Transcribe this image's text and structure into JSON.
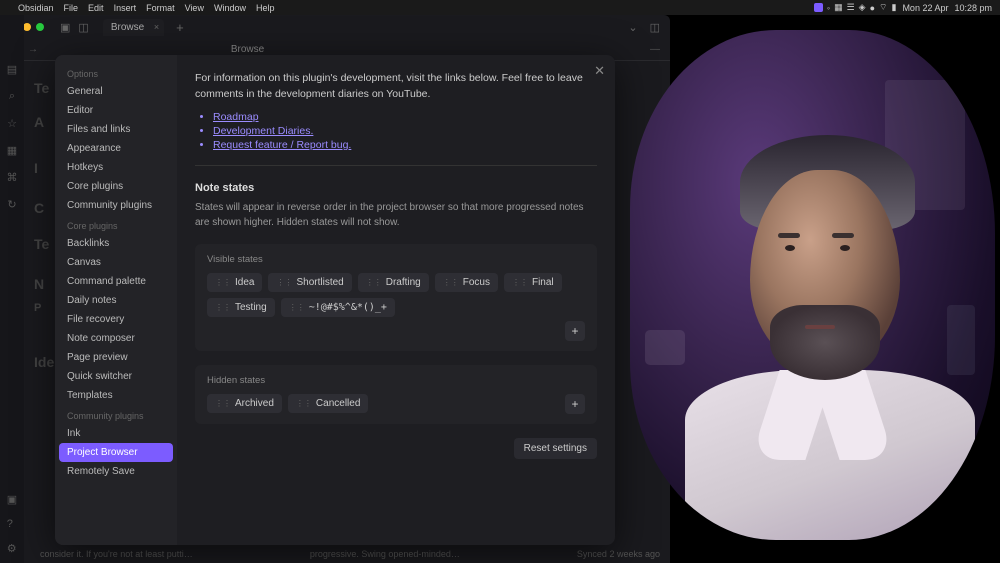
{
  "menubar": {
    "app": "Obsidian",
    "items": [
      "File",
      "Edit",
      "Insert",
      "Format",
      "View",
      "Window",
      "Help"
    ],
    "date": "Mon 22 Apr",
    "time": "10:28 pm"
  },
  "window": {
    "tab_title": "Browse",
    "sub_title": "Browse"
  },
  "bg_doc": {
    "t1": "Te",
    "t2": "A",
    "t3": "I",
    "t4": "C",
    "t5": "Te",
    "t6": "N",
    "t7": "P",
    "t8": "Ide",
    "footer_left": "consider it. If you're not at least putti…",
    "footer_mid": "progressive. Swing opened-minded…",
    "footer_right": "Synced 2 weeks ago"
  },
  "settings": {
    "groups": [
      {
        "label": "Options",
        "items": [
          "General",
          "Editor",
          "Files and links",
          "Appearance",
          "Hotkeys",
          "Core plugins",
          "Community plugins"
        ]
      },
      {
        "label": "Core plugins",
        "items": [
          "Backlinks",
          "Canvas",
          "Command palette",
          "Daily notes",
          "File recovery",
          "Note composer",
          "Page preview",
          "Quick switcher",
          "Templates"
        ]
      },
      {
        "label": "Community plugins",
        "items": [
          "Ink",
          "Project Browser",
          "Remotely Save"
        ]
      }
    ],
    "active": "Project Browser",
    "intro": "For information on this plugin's development, visit the links below. Feel free to leave comments in the development diaries on YouTube.",
    "links": [
      "Roadmap",
      "Development Diaries.",
      "Request feature / Report bug."
    ],
    "section_title": "Note states",
    "section_desc": "States will appear in reverse order in the project browser so that more progressed notes are shown higher. Hidden states will not show.",
    "visible_label": "Visible states",
    "visible_states": [
      "Idea",
      "Shortlisted",
      "Drafting",
      "Focus",
      "Final",
      "Testing",
      "~!@#$%^&*()_+"
    ],
    "hidden_label": "Hidden states",
    "hidden_states": [
      "Archived",
      "Cancelled"
    ],
    "reset": "Reset settings",
    "add": "+"
  }
}
